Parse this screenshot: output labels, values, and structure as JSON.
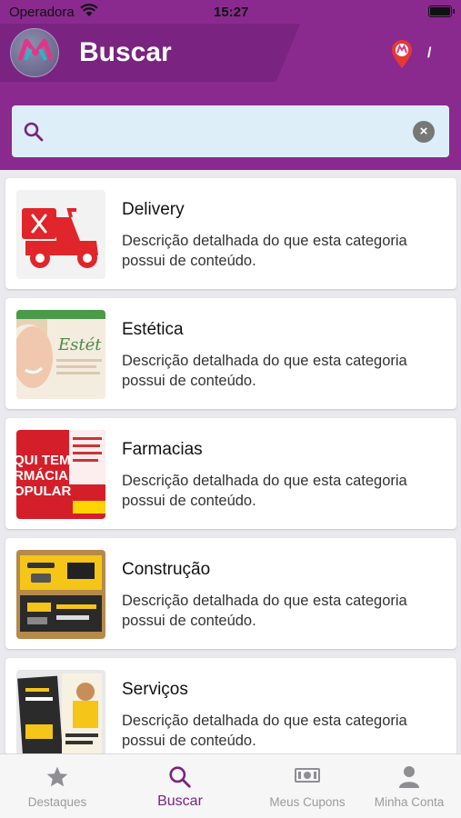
{
  "status_bar": {
    "carrier": "Operadora",
    "time": "15:27"
  },
  "header": {
    "title": "Buscar",
    "location_text": "/"
  },
  "search": {
    "value": "",
    "placeholder": ""
  },
  "categories": [
    {
      "title": "Delivery",
      "description": "Descrição detalhada do que esta categoria possui de conteúdo."
    },
    {
      "title": "Estética",
      "description": "Descrição detalhada do que esta categoria possui de conteúdo.",
      "thumb_text": "Estét"
    },
    {
      "title": "Farmacias",
      "description": "Descrição detalhada do que esta categoria possui de conteúdo.",
      "thumb_text": "QUI TEM\nRMÁCIA\nOPULAR"
    },
    {
      "title": "Construção",
      "description": "Descrição detalhada do que esta categoria possui de conteúdo."
    },
    {
      "title": "Serviços",
      "description": "Descrição detalhada do que esta categoria possui de conteúdo."
    }
  ],
  "tabs": [
    {
      "label": "Destaques",
      "icon": "star-icon",
      "active": false
    },
    {
      "label": "Buscar",
      "icon": "search-icon",
      "active": true
    },
    {
      "label": "Meus Cupons",
      "icon": "money-icon",
      "active": false
    },
    {
      "label": "Minha Conta",
      "icon": "user-icon",
      "active": false
    }
  ],
  "colors": {
    "brand": "#8a2a8f",
    "brand_dark": "#7a2380",
    "search_bg": "#ddeef9",
    "delivery_red": "#e0252b"
  }
}
